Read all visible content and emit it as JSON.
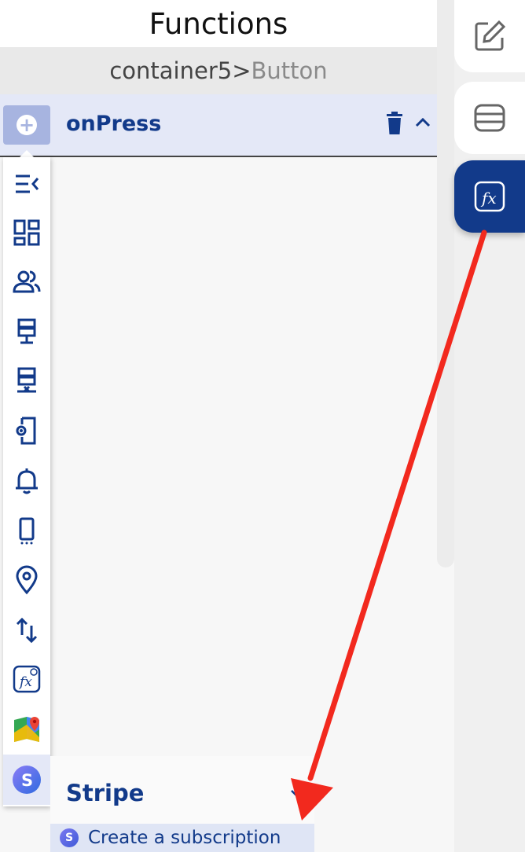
{
  "panel": {
    "title": "Functions",
    "breadcrumb": {
      "parent": "container5",
      "separator": ">",
      "current": "Button"
    }
  },
  "event": {
    "label": "onPress",
    "add_icon": "plus-circle-icon",
    "delete_icon": "trash-icon",
    "collapse_icon": "chevron-up-icon"
  },
  "category_strip": {
    "items": [
      {
        "icon": "collapse-menu-icon"
      },
      {
        "icon": "dashboard-icon"
      },
      {
        "icon": "users-icon"
      },
      {
        "icon": "server-icon"
      },
      {
        "icon": "server-remove-icon"
      },
      {
        "icon": "mobile-settings-icon"
      },
      {
        "icon": "bell-icon"
      },
      {
        "icon": "smartphone-icon"
      },
      {
        "icon": "location-pin-icon"
      },
      {
        "icon": "swap-vertical-icon"
      },
      {
        "icon": "custom-function-icon"
      },
      {
        "icon": "google-maps-icon"
      },
      {
        "icon": "stripe-icon"
      }
    ],
    "active_icon": "stripe-icon"
  },
  "submenu": {
    "title": "Stripe",
    "badge": "S",
    "items": [
      {
        "label": "Create a subscription"
      }
    ]
  },
  "right_rail": {
    "items": [
      {
        "icon": "edit-icon",
        "active": false
      },
      {
        "icon": "database-icon",
        "active": false
      },
      {
        "icon": "function-fx-icon",
        "active": true
      }
    ]
  },
  "colors": {
    "accent": "#123a8a",
    "highlight": "#e4e8f7",
    "annotation": "#f2291e"
  }
}
